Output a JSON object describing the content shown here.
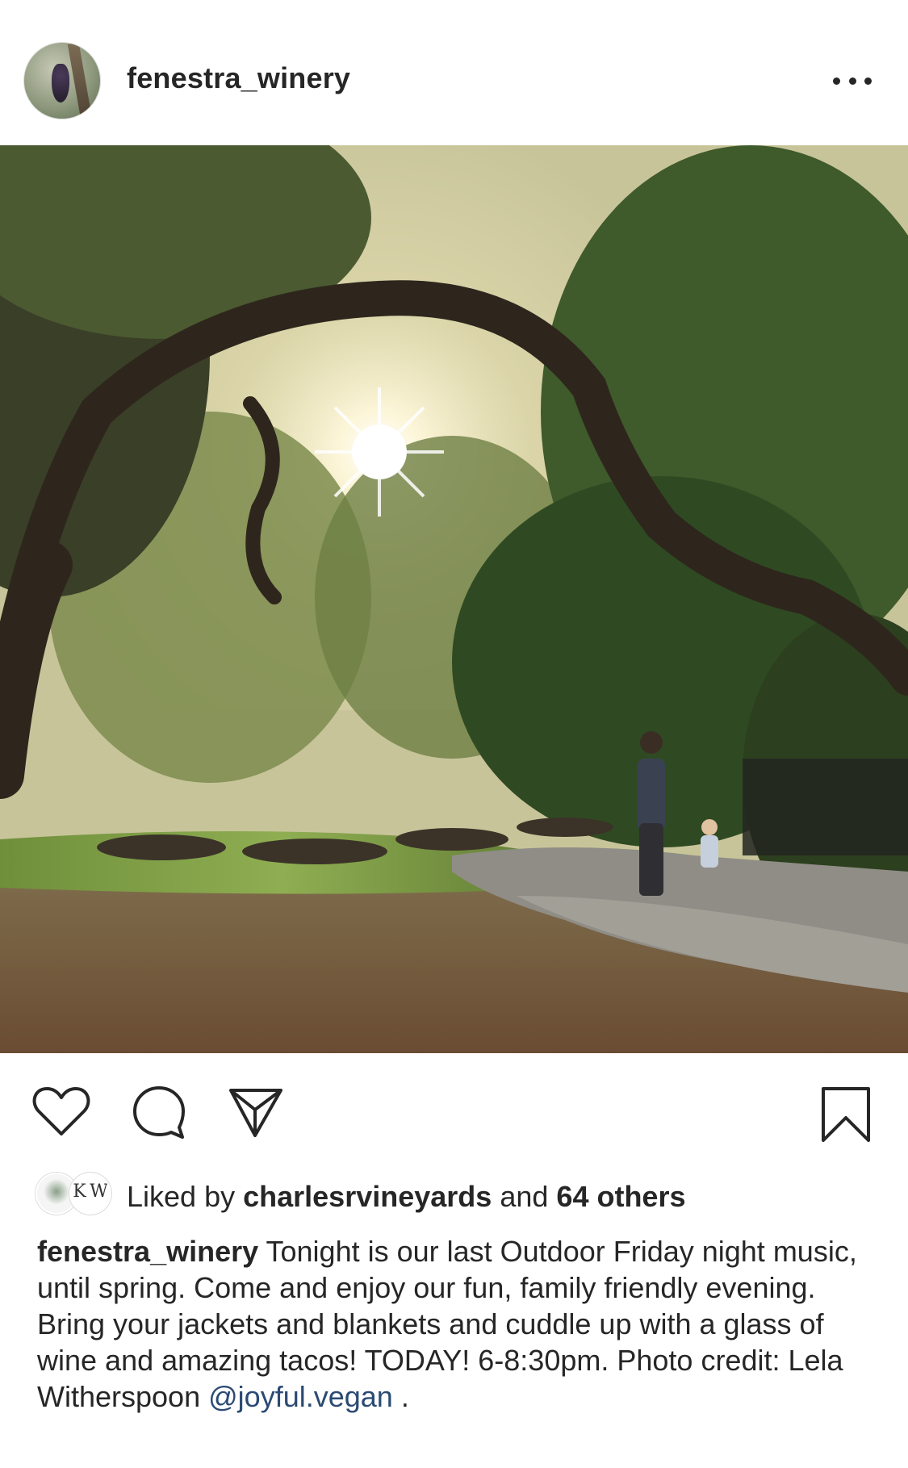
{
  "post": {
    "username": "fenestra_winery",
    "more_icon": "more-horizontal-icon",
    "photo_alt": "",
    "actions": {
      "like_icon": "heart-icon",
      "comment_icon": "comment-icon",
      "share_icon": "send-icon",
      "save_icon": "bookmark-icon"
    },
    "likes": {
      "prefix": "Liked by",
      "first_liker": "charlesrvineyards",
      "connector": "and",
      "others": "64 others",
      "avatar2_text": "K W"
    },
    "caption": {
      "username": "fenestra_winery",
      "text": "Tonight is our last Outdoor Friday night music, until spring. Come and enjoy our fun, family friendly evening. Bring your jackets and blankets and cuddle up with a glass of wine and amazing tacos! TODAY! 6-8:30pm. Photo credit: Lela Witherspoon",
      "mention": "@joyful.vegan",
      "trailing": "."
    }
  },
  "colors": {
    "text": "#262626",
    "mention": "#2b4a73",
    "border": "#dbdbdb"
  }
}
